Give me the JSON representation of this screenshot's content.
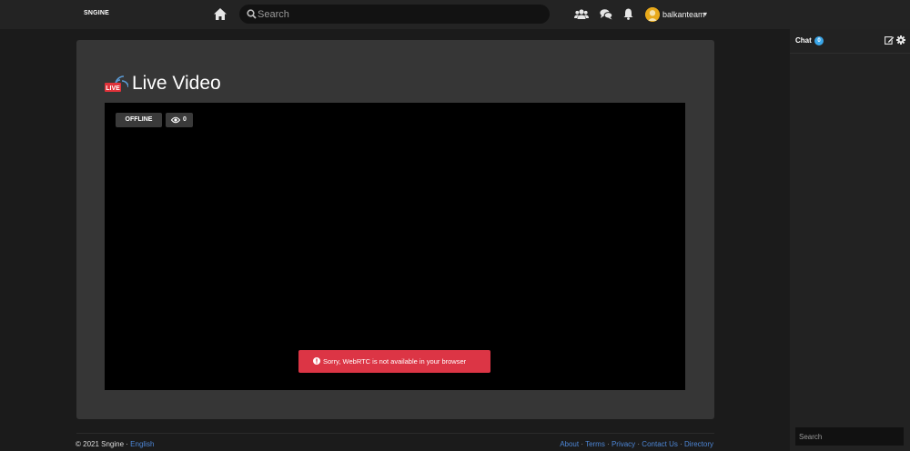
{
  "header": {
    "logo": "SNGINE",
    "search_placeholder": "Search",
    "user_name": "balkanteam",
    "icons": [
      "home-icon",
      "search-icon",
      "friends-icon",
      "messages-icon",
      "notifications-icon",
      "chevron-down-icon"
    ]
  },
  "main": {
    "title": "Live Video",
    "live_icon_text": "LIVE",
    "status_badge": "OFFLINE",
    "viewers_count": "0",
    "alert_text": "Sorry, WebRTC is not available in your browser"
  },
  "footer": {
    "copyright": "© 2021 Sngine · ",
    "language": "English",
    "links": [
      "About",
      "Terms",
      "Privacy",
      "Contact Us",
      "Directory"
    ],
    "separator": " · "
  },
  "chat": {
    "title": "Chat",
    "online_count": "0",
    "search_placeholder": "Search",
    "icons": [
      "edit-icon",
      "gear-icon"
    ]
  },
  "colors": {
    "background": "#1b1b1b",
    "topbar": "#232323",
    "card": "#363636",
    "alert": "#dc3545",
    "link": "#4d86d6",
    "chat_badge": "#3aa6e8"
  }
}
